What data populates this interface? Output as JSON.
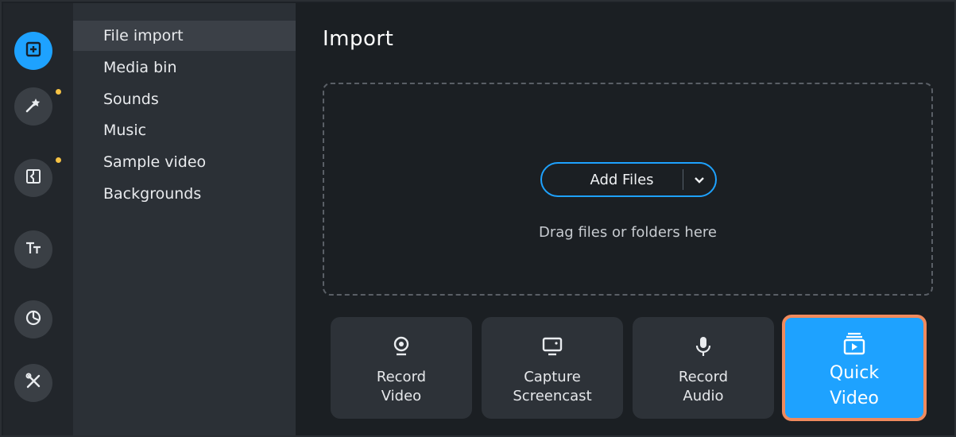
{
  "colors": {
    "accent": "#1ea2ff",
    "highlight_outline": "#f08a5d",
    "notification_dot": "#f6c244"
  },
  "rail": {
    "items": [
      {
        "icon": "import-icon",
        "active": true
      },
      {
        "icon": "magic-wand-icon",
        "has_dot": true
      },
      {
        "icon": "transitions-icon",
        "has_dot": true
      },
      {
        "icon": "titles-icon"
      },
      {
        "icon": "stickers-icon"
      },
      {
        "icon": "tools-icon"
      }
    ]
  },
  "submenu": {
    "items": [
      {
        "label": "File import",
        "selected": true
      },
      {
        "label": "Media bin"
      },
      {
        "label": "Sounds"
      },
      {
        "label": "Music"
      },
      {
        "label": "Sample video"
      },
      {
        "label": "Backgrounds"
      }
    ]
  },
  "main": {
    "title": "Import",
    "add_files_label": "Add Files",
    "drag_hint": "Drag files or folders here",
    "tiles": [
      {
        "line1": "Record",
        "line2": "Video",
        "icon": "webcam-icon"
      },
      {
        "line1": "Capture",
        "line2": "Screencast",
        "icon": "monitor-icon"
      },
      {
        "line1": "Record",
        "line2": "Audio",
        "icon": "microphone-icon"
      },
      {
        "line1": "Quick",
        "line2": "Video",
        "icon": "quick-video-icon"
      }
    ]
  }
}
